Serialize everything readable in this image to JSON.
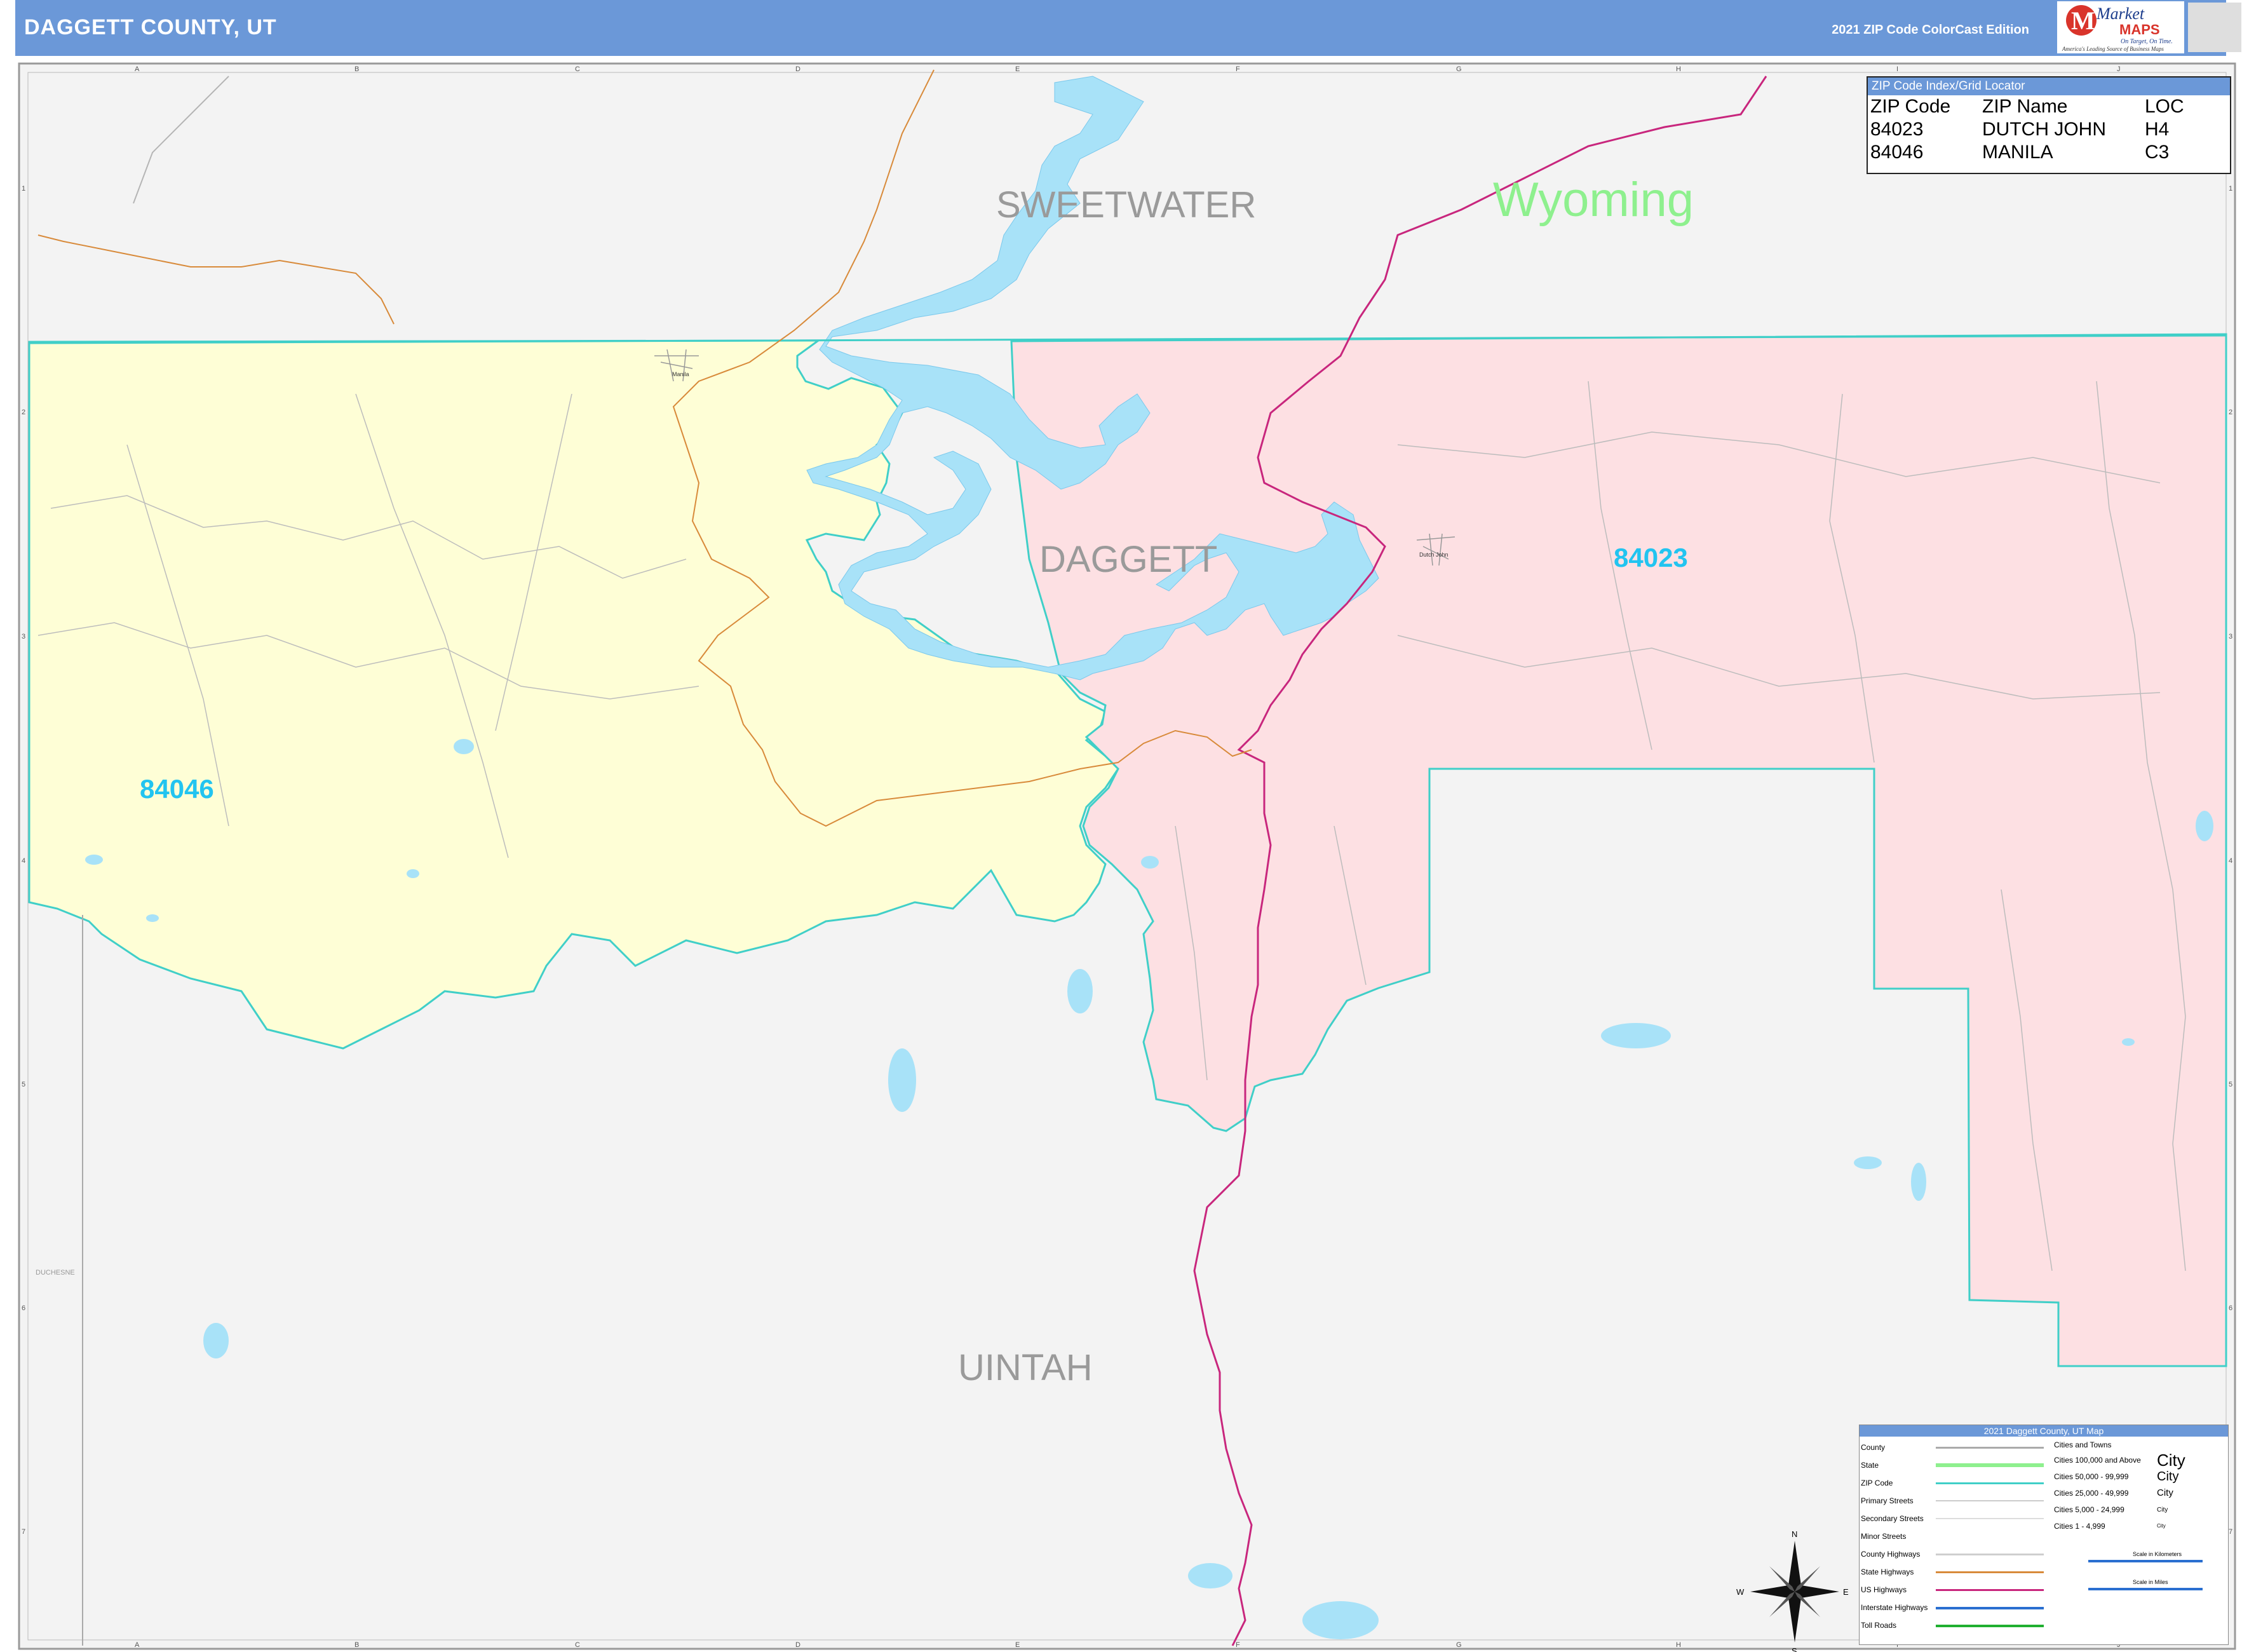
{
  "header": {
    "title": "DAGGETT COUNTY, UT",
    "edition": "2021 ZIP Code ColorCast Edition",
    "logo_main": "Market",
    "logo_maps": "MAPS",
    "logo_tagline": "On Target, On Time.",
    "logo_subtitle": "America's Leading Source of Business Maps"
  },
  "colors": {
    "header_bg": "#6b98d8",
    "zip_84046": "#fefed6",
    "zip_84023": "#fde0e3",
    "zip_label": "#22c4f0",
    "water": "#a8e2f8",
    "zip_boundary": "#40cfc8",
    "state_label": "#8ef08e",
    "us_highway": "#c8267d",
    "state_highway": "#d88a3a"
  },
  "map": {
    "state_label": "Wyoming",
    "county_labels": [
      "SWEETWATER",
      "DAGGETT",
      "UINTAH"
    ],
    "small_county_label": "DUCHESNE",
    "grid_columns": [
      "A",
      "B",
      "C",
      "D",
      "E",
      "F",
      "G",
      "H",
      "I",
      "J"
    ],
    "grid_rows": [
      "1",
      "2",
      "3",
      "4",
      "5",
      "6",
      "7"
    ],
    "zip_areas": [
      {
        "zip": "84046",
        "name": "MANILA"
      },
      {
        "zip": "84023",
        "name": "DUTCH JOHN"
      }
    ],
    "cities": [
      "Manila",
      "Dutch John"
    ]
  },
  "zip_index": {
    "title": "ZIP Code Index/Grid Locator",
    "headers": [
      "ZIP Code",
      "ZIP Name",
      "LOC"
    ],
    "rows": [
      [
        "84023",
        "DUTCH JOHN",
        "H4"
      ],
      [
        "84046",
        "MANILA",
        "C3"
      ]
    ]
  },
  "legend": {
    "title": "2021 Daggett County, UT Map",
    "line_items": [
      "County",
      "State",
      "ZIP Code",
      "Primary Streets",
      "Secondary Streets",
      "Minor Streets",
      "County Highways",
      "State Highways",
      "US Highways",
      "Interstate Highways",
      "Toll Roads"
    ],
    "cities_heading": "Cities and Towns",
    "city_ranges": [
      "Cities 100,000 and Above",
      "Cities 50,000 - 99,999",
      "Cities 25,000 - 49,999",
      "Cities 5,000 - 24,999",
      "Cities 1 - 4,999"
    ],
    "city_samples": [
      "City",
      "City",
      "City",
      "City",
      "City"
    ],
    "scale_km": "Scale in Kilometers",
    "scale_mi": "Scale in Miles",
    "compass": [
      "N",
      "E",
      "S",
      "W"
    ]
  }
}
